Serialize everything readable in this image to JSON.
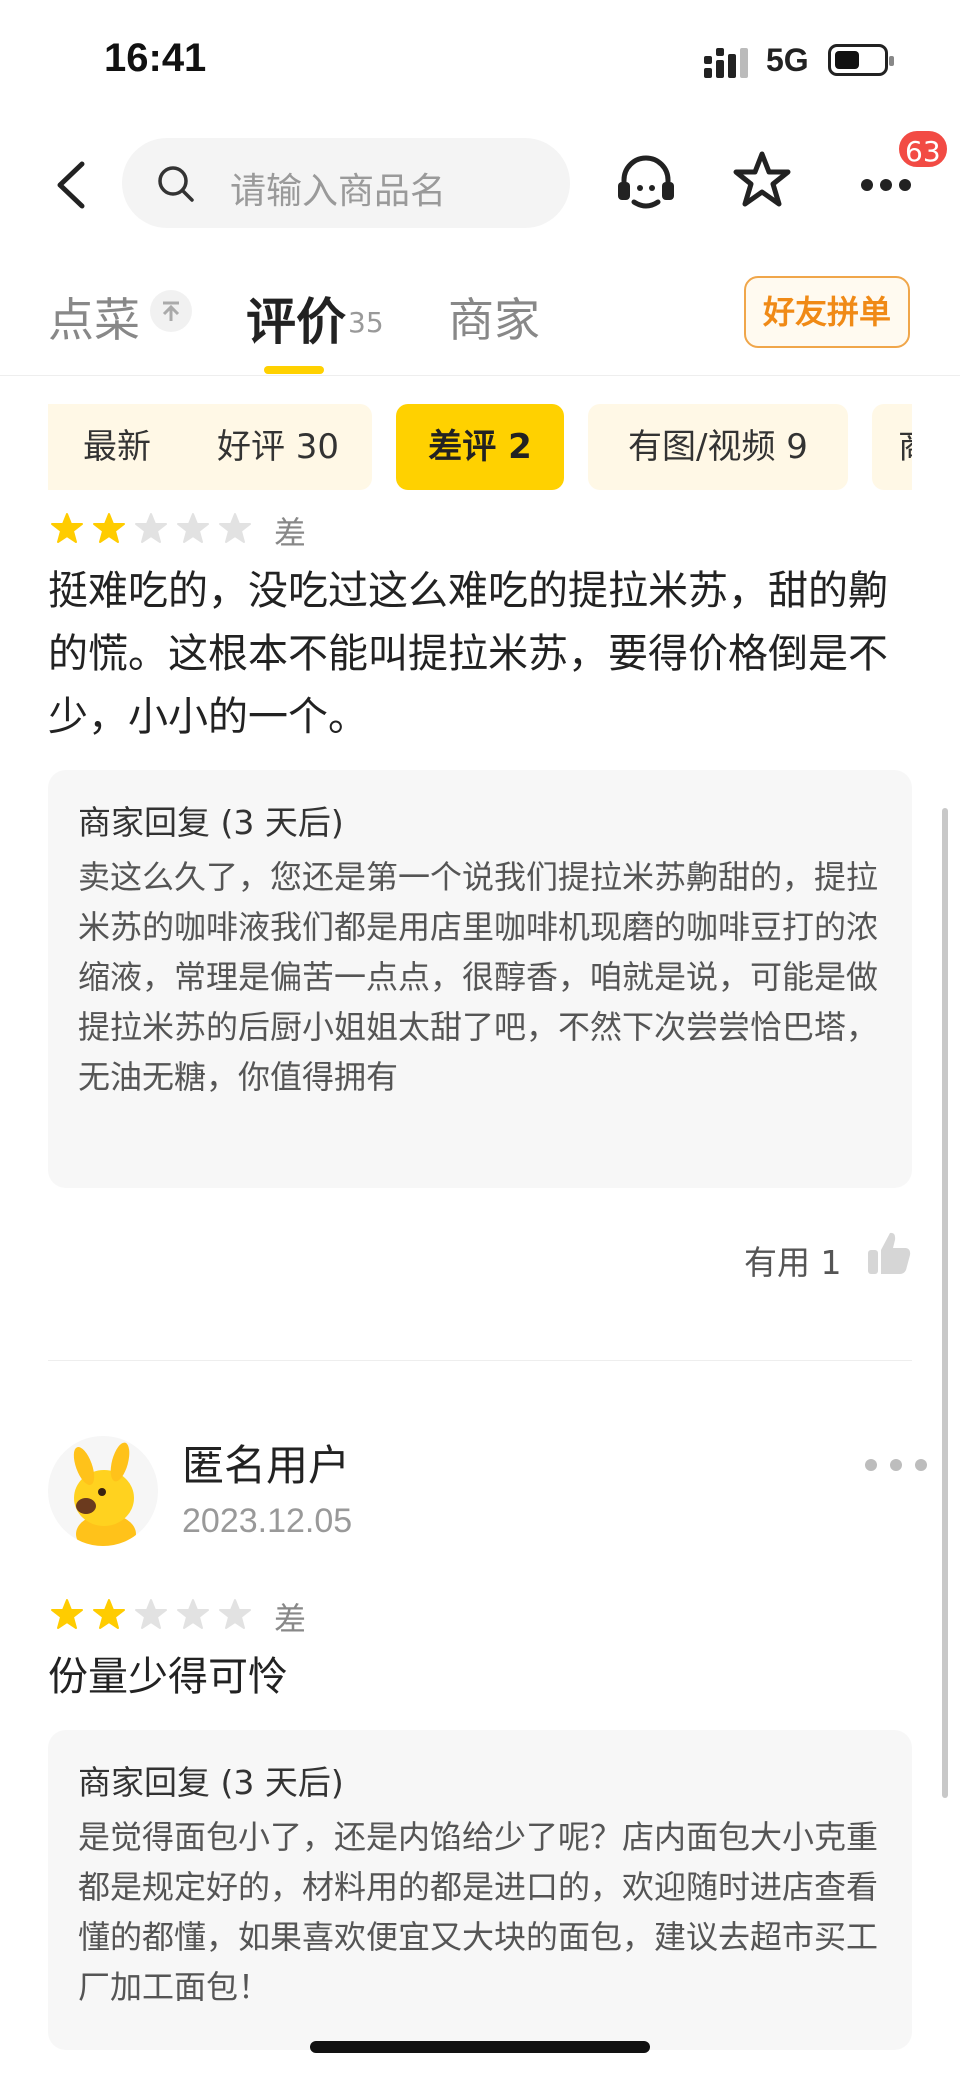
{
  "status": {
    "time": "16:41",
    "network": "5G"
  },
  "search": {
    "placeholder": "请输入商品名"
  },
  "top": {
    "badge": "63"
  },
  "tabs": {
    "menu": "点菜",
    "reviews": "评价",
    "reviews_count": "35",
    "merchant": "商家",
    "group_order": "好友拼单"
  },
  "filters": [
    {
      "label": "最新"
    },
    {
      "label": "好评 30"
    },
    {
      "label": "差评 2",
      "active": true
    },
    {
      "label": "有图/视频 9"
    },
    {
      "label": "商"
    }
  ],
  "review1": {
    "rating_label": "差",
    "rating": 2,
    "text": "挺难吃的，没吃过这么难吃的提拉米苏，甜的齁的慌。这根本不能叫提拉米苏，要得价格倒是不少，小小的一个。",
    "reply_title": "商家回复 (3 天后)",
    "reply_text": "卖这么久了，您还是第一个说我们提拉米苏齁甜的，提拉米苏的咖啡液我们都是用店里咖啡机现磨的咖啡豆打的浓缩液，常理是偏苦一点点，很醇香，咱就是说，可能是做提拉米苏的后厨小姐姐太甜了吧，不然下次尝尝恰巴塔，无油无糖，你值得拥有",
    "useful": "有用 1"
  },
  "review2": {
    "user": "匿名用户",
    "date": "2023.12.05",
    "rating_label": "差",
    "rating": 2,
    "text": "份量少得可怜",
    "reply_title": "商家回复 (3 天后)",
    "reply_text": "是觉得面包小了，还是内馅给少了呢？店内面包大小克重都是规定好的，材料用的都是进口的，欢迎随时进店查看懂的都懂，如果喜欢便宜又大块的面包，建议去超市买工厂加工面包！"
  },
  "colors": {
    "accent": "#ffd100",
    "star_on": "#ffcc00",
    "star_off": "#e2e2e2",
    "badge": "#f24b44"
  }
}
